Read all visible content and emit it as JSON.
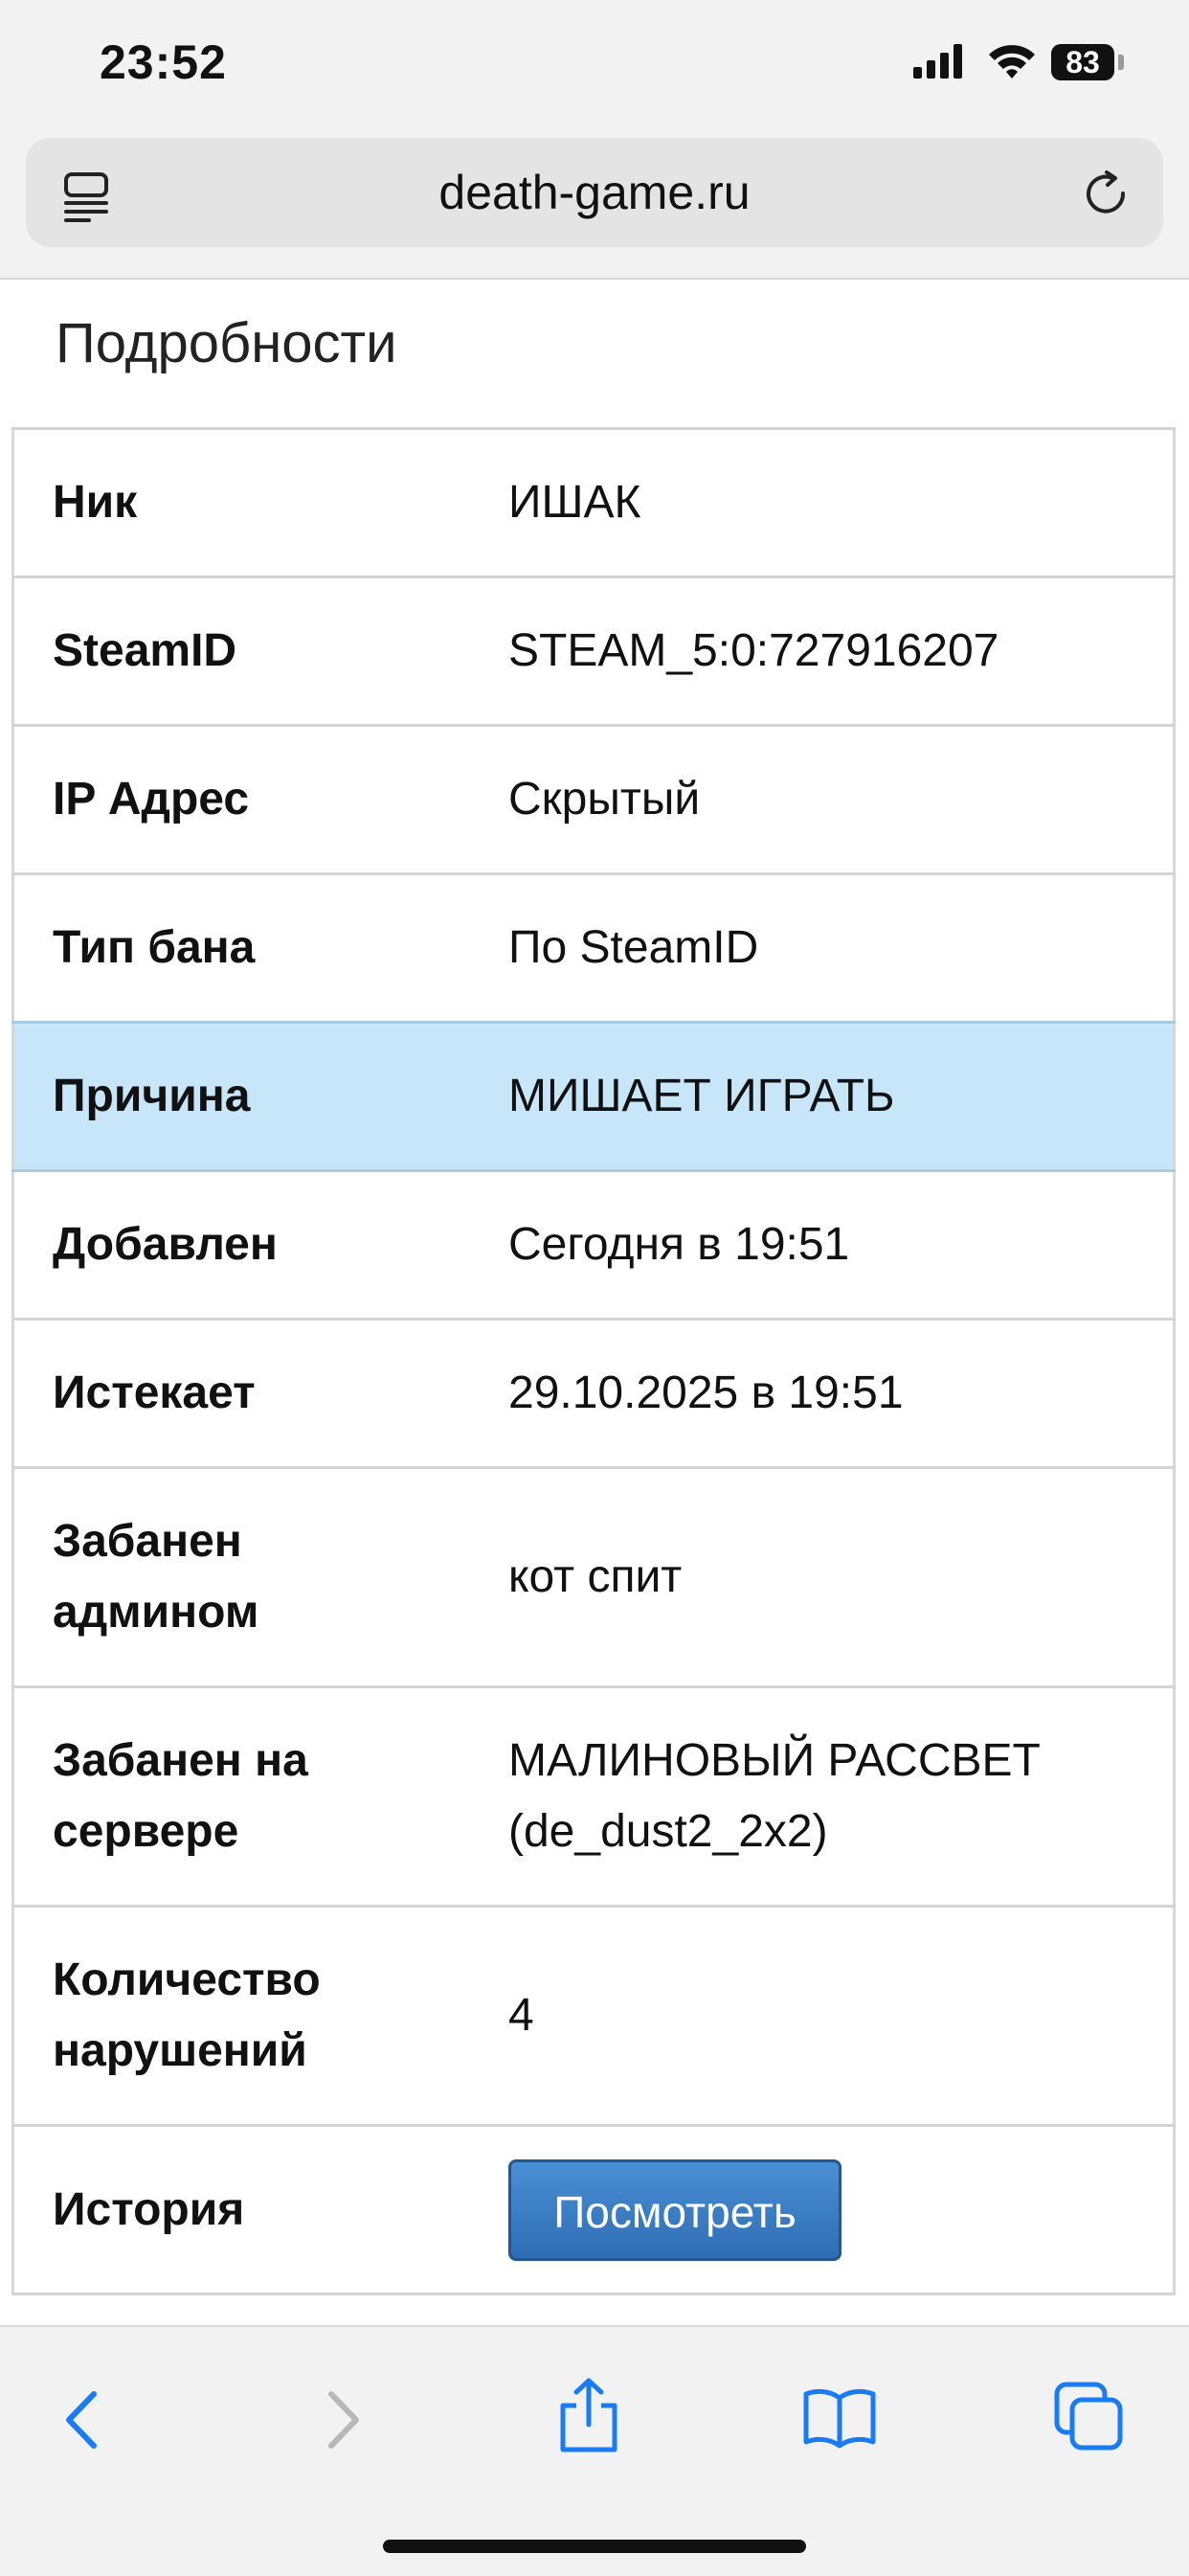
{
  "status_bar": {
    "time": "23:52",
    "battery": "83"
  },
  "browser": {
    "url": "death-game.ru"
  },
  "page": {
    "title": "Подробности",
    "rows": [
      {
        "label": "Ник",
        "value": "ИШАК"
      },
      {
        "label": "SteamID",
        "value": "STEAM_5:0:727916207"
      },
      {
        "label": "IP Адрес",
        "value": "Скрытый"
      },
      {
        "label": "Тип бана",
        "value": "По SteamID"
      },
      {
        "label": "Причина",
        "value": "МИШАЕТ ИГРАТЬ"
      },
      {
        "label": "Добавлен",
        "value": "Сегодня в 19:51"
      },
      {
        "label": "Истекает",
        "value": "29.10.2025 в 19:51"
      },
      {
        "label_line1": "Забанен",
        "label_line2": "админом",
        "value": "кот спит"
      },
      {
        "label_line1": "Забанен на",
        "label_line2": "сервере",
        "value_line1": "МАЛИНОВЫЙ РАССВЕТ",
        "value_line2": "(de_dust2_2x2)"
      },
      {
        "label_line1": "Количество",
        "label_line2": "нарушений",
        "value": "4"
      },
      {
        "label": "История",
        "button": "Посмотреть"
      }
    ]
  },
  "icons": {
    "signal": "cellular-signal-icon",
    "wifi": "wifi-icon",
    "page_menu": "page-menu-icon",
    "reload": "reload-icon",
    "back": "back-icon",
    "forward": "forward-icon",
    "share": "share-icon",
    "bookmarks": "bookmarks-icon",
    "tabs": "tabs-icon"
  },
  "colors": {
    "highlight_row": "#c8e6fa",
    "button": "#3a7cc4",
    "ios_blue": "#1a7cf5"
  }
}
